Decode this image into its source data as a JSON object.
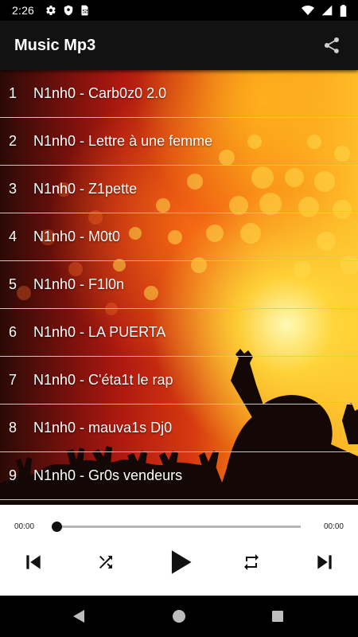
{
  "status_bar": {
    "time": "2:26",
    "left_icons": [
      "gear-icon",
      "shield-icon",
      "sim-card-icon"
    ],
    "right_icons": [
      "wifi-icon",
      "signal-icon",
      "battery-icon"
    ]
  },
  "app_bar": {
    "title": "Music Mp3",
    "share_icon": "share-icon"
  },
  "tracks": [
    {
      "number": "1",
      "title": "N1nh0 - Carb0z0 2.0"
    },
    {
      "number": "2",
      "title": "N1nh0 - Lettre à une femme"
    },
    {
      "number": "3",
      "title": "N1nh0 - Z1pette"
    },
    {
      "number": "4",
      "title": "N1nh0 - M0t0"
    },
    {
      "number": "5",
      "title": "N1nh0 - F1l0n"
    },
    {
      "number": "6",
      "title": "N1nh0 - LA PUERTA"
    },
    {
      "number": "7",
      "title": "N1nh0 - C'éta1t le rap"
    },
    {
      "number": "8",
      "title": "N1nh0 - mauva1s Dj0"
    },
    {
      "number": "9",
      "title": "N1nh0 - Gr0s vendeurs"
    }
  ],
  "player": {
    "elapsed": "00:00",
    "total": "00:00",
    "progress": 0,
    "controls": [
      "skip-previous-icon",
      "shuffle-icon",
      "play-icon",
      "repeat-icon",
      "skip-next-icon"
    ]
  },
  "colors": {
    "app_bar_bg": "#121212",
    "player_bg": "#ffffff",
    "divider": "#c7c7c7"
  }
}
